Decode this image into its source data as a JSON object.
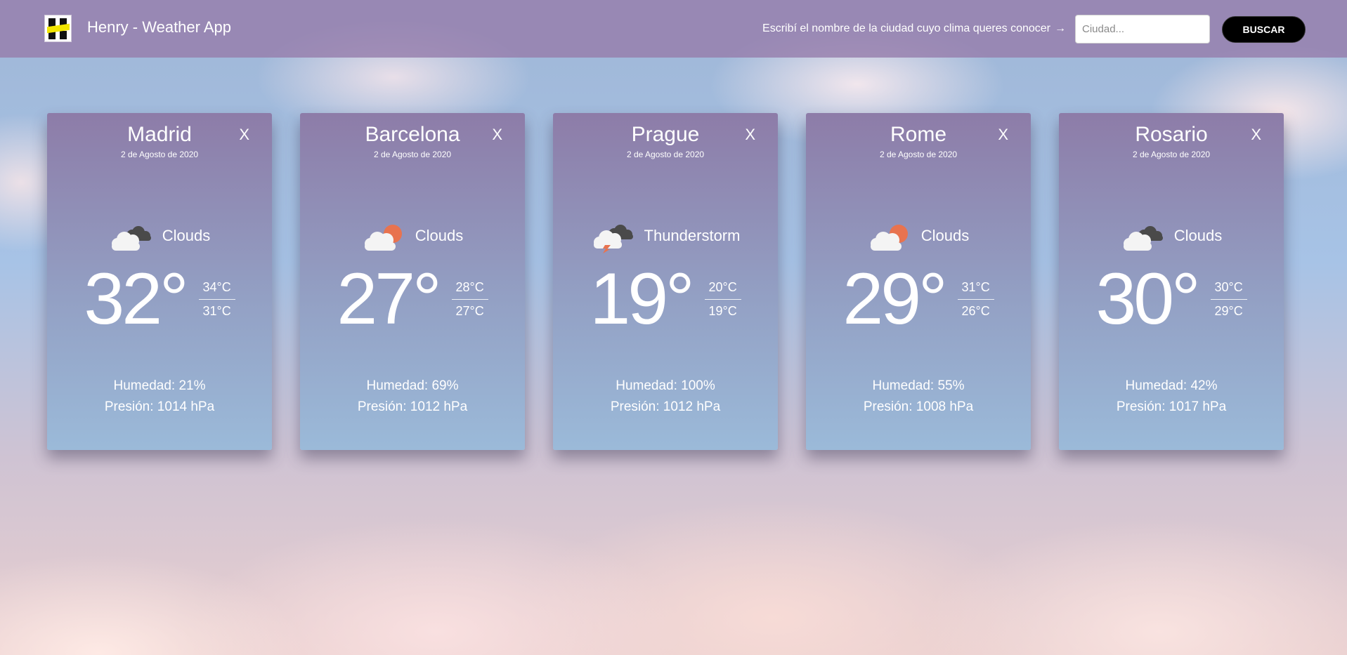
{
  "app": {
    "title": "Henry - Weather App"
  },
  "search": {
    "hint": "Escribí el nombre de la ciudad cuyo clima queres conocer",
    "arrow": "→",
    "placeholder": "Ciudad...",
    "value": "",
    "button_label": "BUSCAR"
  },
  "icons": {
    "logo": "henry-logo",
    "clouds": "clouds-icon",
    "partly_cloudy": "sun-behind-cloud-icon",
    "thunderstorm": "thunderstorm-icon"
  },
  "colors": {
    "navbar": "#967eac",
    "card_top": "#8d7ca8",
    "card_bottom": "#9bbad9",
    "sun": "#e8734f",
    "dark_cloud": "#444444",
    "button": "#000000"
  },
  "cards": [
    {
      "city": "Madrid",
      "date": "2 de Agosto de 2020",
      "close": "X",
      "icon": "clouds-icon",
      "condition": "Clouds",
      "temp": "32°",
      "max": "34°C",
      "min": "31°C",
      "humidity": "Humedad: 21%",
      "pressure": "Presión: 1014 hPa"
    },
    {
      "city": "Barcelona",
      "date": "2 de Agosto de 2020",
      "close": "X",
      "icon": "sun-behind-cloud-icon",
      "condition": "Clouds",
      "temp": "27°",
      "max": "28°C",
      "min": "27°C",
      "humidity": "Humedad: 69%",
      "pressure": "Presión: 1012 hPa"
    },
    {
      "city": "Prague",
      "date": "2 de Agosto de 2020",
      "close": "X",
      "icon": "thunderstorm-icon",
      "condition": "Thunderstorm",
      "temp": "19°",
      "max": "20°C",
      "min": "19°C",
      "humidity": "Humedad: 100%",
      "pressure": "Presión: 1012 hPa"
    },
    {
      "city": "Rome",
      "date": "2 de Agosto de 2020",
      "close": "X",
      "icon": "sun-behind-cloud-icon",
      "condition": "Clouds",
      "temp": "29°",
      "max": "31°C",
      "min": "26°C",
      "humidity": "Humedad: 55%",
      "pressure": "Presión: 1008 hPa"
    },
    {
      "city": "Rosario",
      "date": "2 de Agosto de 2020",
      "close": "X",
      "icon": "clouds-icon",
      "condition": "Clouds",
      "temp": "30°",
      "max": "30°C",
      "min": "29°C",
      "humidity": "Humedad: 42%",
      "pressure": "Presión: 1017 hPa"
    }
  ]
}
